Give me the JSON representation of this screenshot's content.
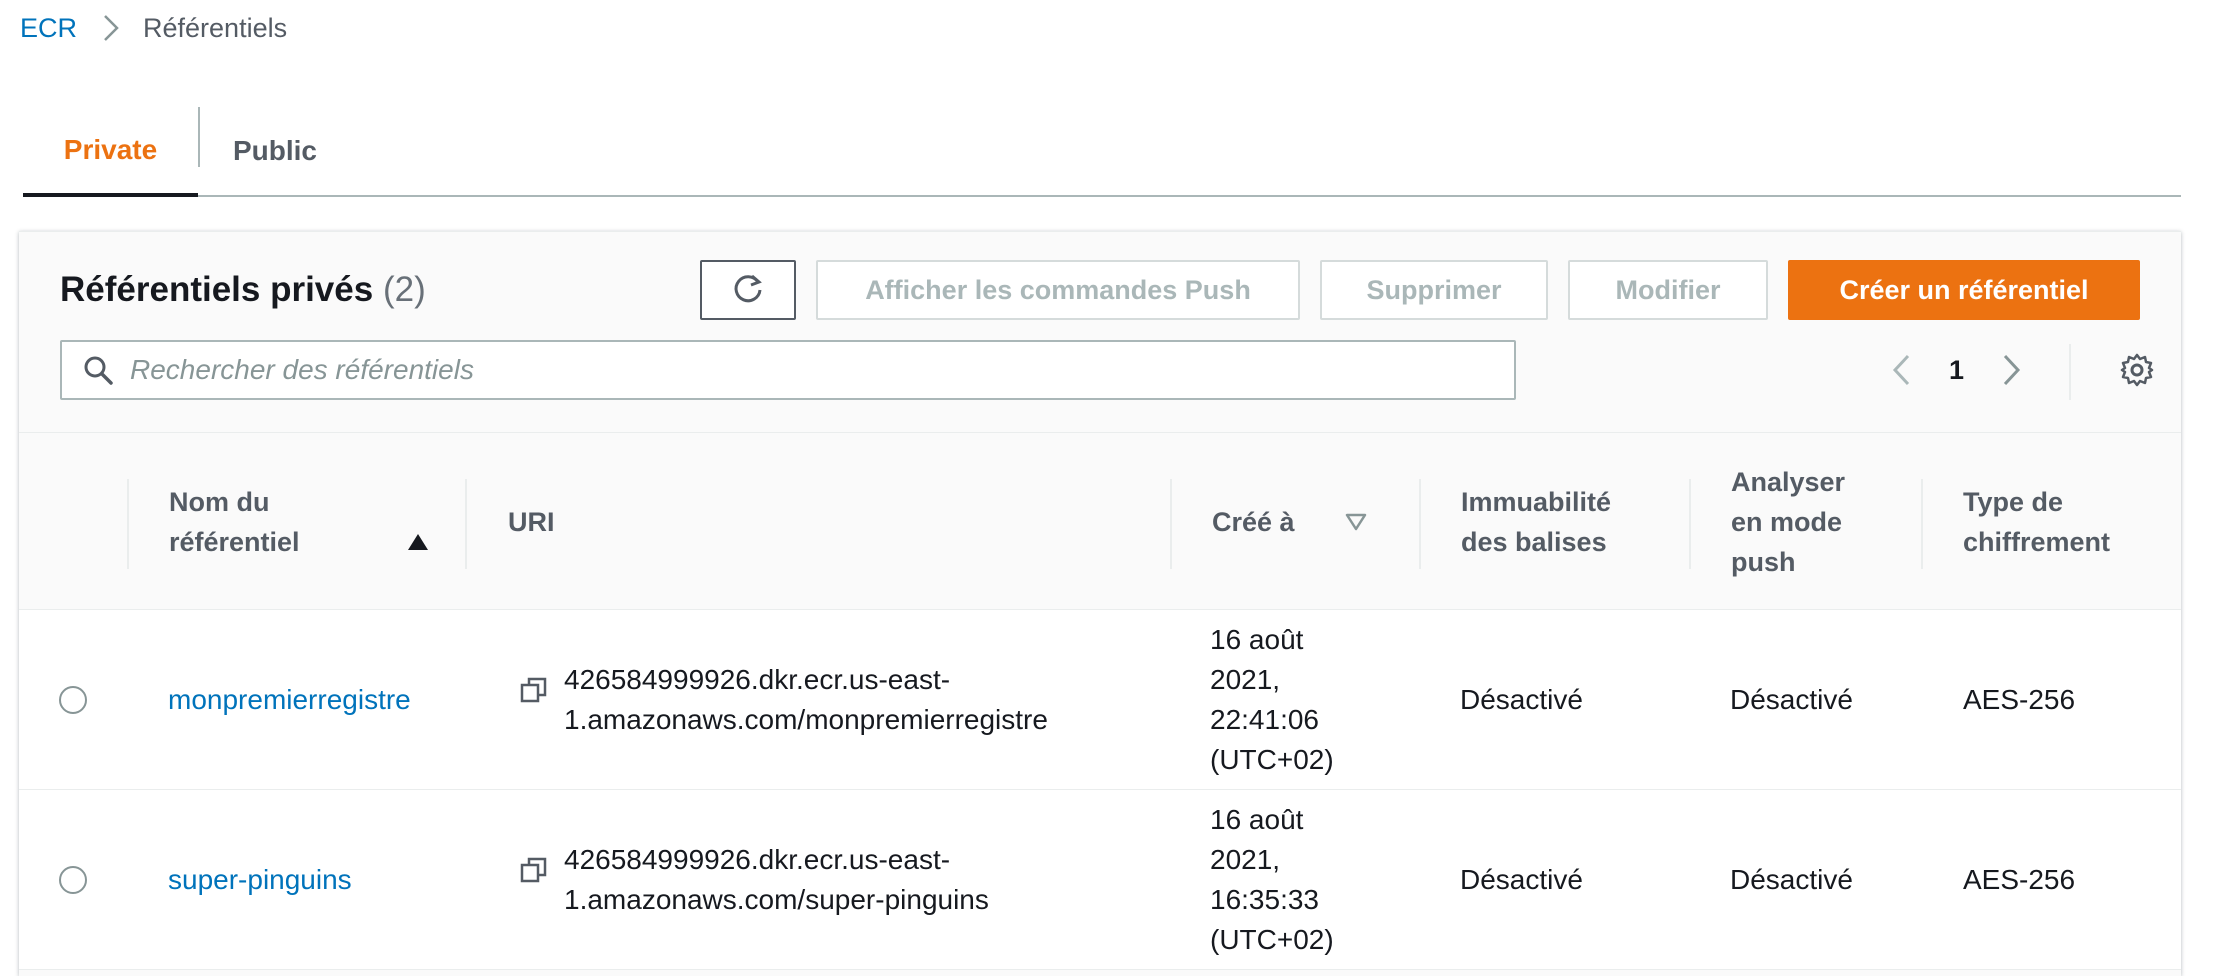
{
  "breadcrumb": {
    "root": "ECR",
    "current": "Référentiels"
  },
  "tabs": [
    {
      "label": "Private"
    },
    {
      "label": "Public"
    }
  ],
  "header": {
    "title": "Référentiels privés",
    "count": "(2)"
  },
  "toolbar": {
    "push_commands": "Afficher les commandes Push",
    "delete": "Supprimer",
    "edit": "Modifier",
    "create": "Créer un référentiel"
  },
  "search": {
    "placeholder": "Rechercher des référentiels"
  },
  "pagination": {
    "page": "1"
  },
  "columns": [
    "Nom du référentiel",
    "URI",
    "Créé à",
    "Immuabilité des balises",
    "Analyser en mode push",
    "Type de chiffrement"
  ],
  "rows": [
    {
      "name": "monpremierregistre",
      "uri_line1": "426584999926.dkr.ecr.us-east-",
      "uri_line2": "1.amazonaws.com/monpremierregistre",
      "created_l1": "16 août",
      "created_l2": "2021,",
      "created_l3": "22:41:06",
      "created_l4": "(UTC+02)",
      "immutability": "Désactivé",
      "scan_on_push": "Désactivé",
      "encryption": "AES-256"
    },
    {
      "name": "super-pinguins",
      "uri_line1": "426584999926.dkr.ecr.us-east-",
      "uri_line2": "1.amazonaws.com/super-pinguins",
      "created_l1": "16 août",
      "created_l2": "2021,",
      "created_l3": "16:35:33",
      "created_l4": "(UTC+02)",
      "immutability": "Désactivé",
      "scan_on_push": "Désactivé",
      "encryption": "AES-256"
    }
  ],
  "colors": {
    "accent": "#ec7211",
    "link": "#0073bb",
    "text": "#16191f",
    "muted": "#545b64"
  }
}
